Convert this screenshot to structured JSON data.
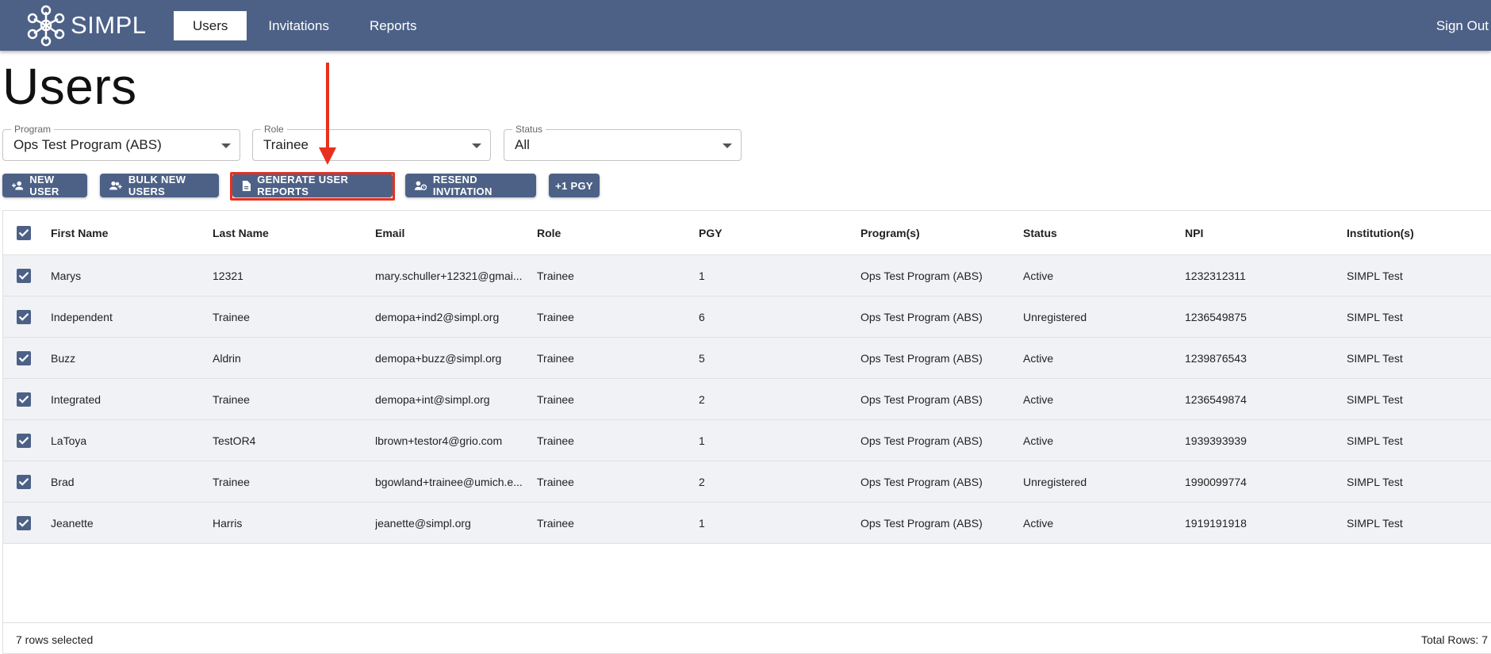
{
  "app": {
    "logo_text": "SIMPL",
    "nav": [
      {
        "label": "Users",
        "active": true
      },
      {
        "label": "Invitations",
        "active": false
      },
      {
        "label": "Reports",
        "active": false
      }
    ],
    "signout_label": "Sign Out"
  },
  "page": {
    "title": "Users"
  },
  "filters": {
    "program": {
      "label": "Program",
      "value": "Ops Test Program (ABS)"
    },
    "role": {
      "label": "Role",
      "value": "Trainee"
    },
    "status": {
      "label": "Status",
      "value": "All"
    }
  },
  "actions": {
    "new_user": "NEW USER",
    "bulk_new_users": "BULK NEW USERS",
    "generate_reports": "GENERATE USER REPORTS",
    "resend_invitation": "RESEND INVITATION",
    "plus_pgy": "+1 PGY"
  },
  "table": {
    "columns": [
      "First Name",
      "Last Name",
      "Email",
      "Role",
      "PGY",
      "Program(s)",
      "Status",
      "NPI",
      "Institution(s)"
    ],
    "rows": [
      {
        "first": "Marys",
        "last": "12321",
        "email": "mary.schuller+12321@gmai...",
        "role": "Trainee",
        "pgy": "1",
        "program": "Ops Test Program (ABS)",
        "status": "Active",
        "npi": "1232312311",
        "institution": "SIMPL Test",
        "checked": true
      },
      {
        "first": "Independent",
        "last": "Trainee",
        "email": "demopa+ind2@simpl.org",
        "role": "Trainee",
        "pgy": "6",
        "program": "Ops Test Program (ABS)",
        "status": "Unregistered",
        "npi": "1236549875",
        "institution": "SIMPL Test",
        "checked": true
      },
      {
        "first": "Buzz",
        "last": "Aldrin",
        "email": "demopa+buzz@simpl.org",
        "role": "Trainee",
        "pgy": "5",
        "program": "Ops Test Program (ABS)",
        "status": "Active",
        "npi": "1239876543",
        "institution": "SIMPL Test",
        "checked": true
      },
      {
        "first": "Integrated",
        "last": "Trainee",
        "email": "demopa+int@simpl.org",
        "role": "Trainee",
        "pgy": "2",
        "program": "Ops Test Program (ABS)",
        "status": "Active",
        "npi": "1236549874",
        "institution": "SIMPL Test",
        "checked": true
      },
      {
        "first": "LaToya",
        "last": "TestOR4",
        "email": "lbrown+testor4@grio.com",
        "role": "Trainee",
        "pgy": "1",
        "program": "Ops Test Program (ABS)",
        "status": "Active",
        "npi": "1939393939",
        "institution": "SIMPL Test",
        "checked": true
      },
      {
        "first": "Brad",
        "last": "Trainee",
        "email": "bgowland+trainee@umich.e...",
        "role": "Trainee",
        "pgy": "2",
        "program": "Ops Test Program (ABS)",
        "status": "Unregistered",
        "npi": "1990099774",
        "institution": "SIMPL Test",
        "checked": true
      },
      {
        "first": "Jeanette",
        "last": "Harris",
        "email": "jeanette@simpl.org",
        "role": "Trainee",
        "pgy": "1",
        "program": "Ops Test Program (ABS)",
        "status": "Active",
        "npi": "1919191918",
        "institution": "SIMPL Test",
        "checked": true
      }
    ],
    "footer_selected": "7 rows selected",
    "footer_total": "Total Rows: 7"
  },
  "colors": {
    "primary": "#4d6187",
    "annotation": "#e8301c"
  }
}
